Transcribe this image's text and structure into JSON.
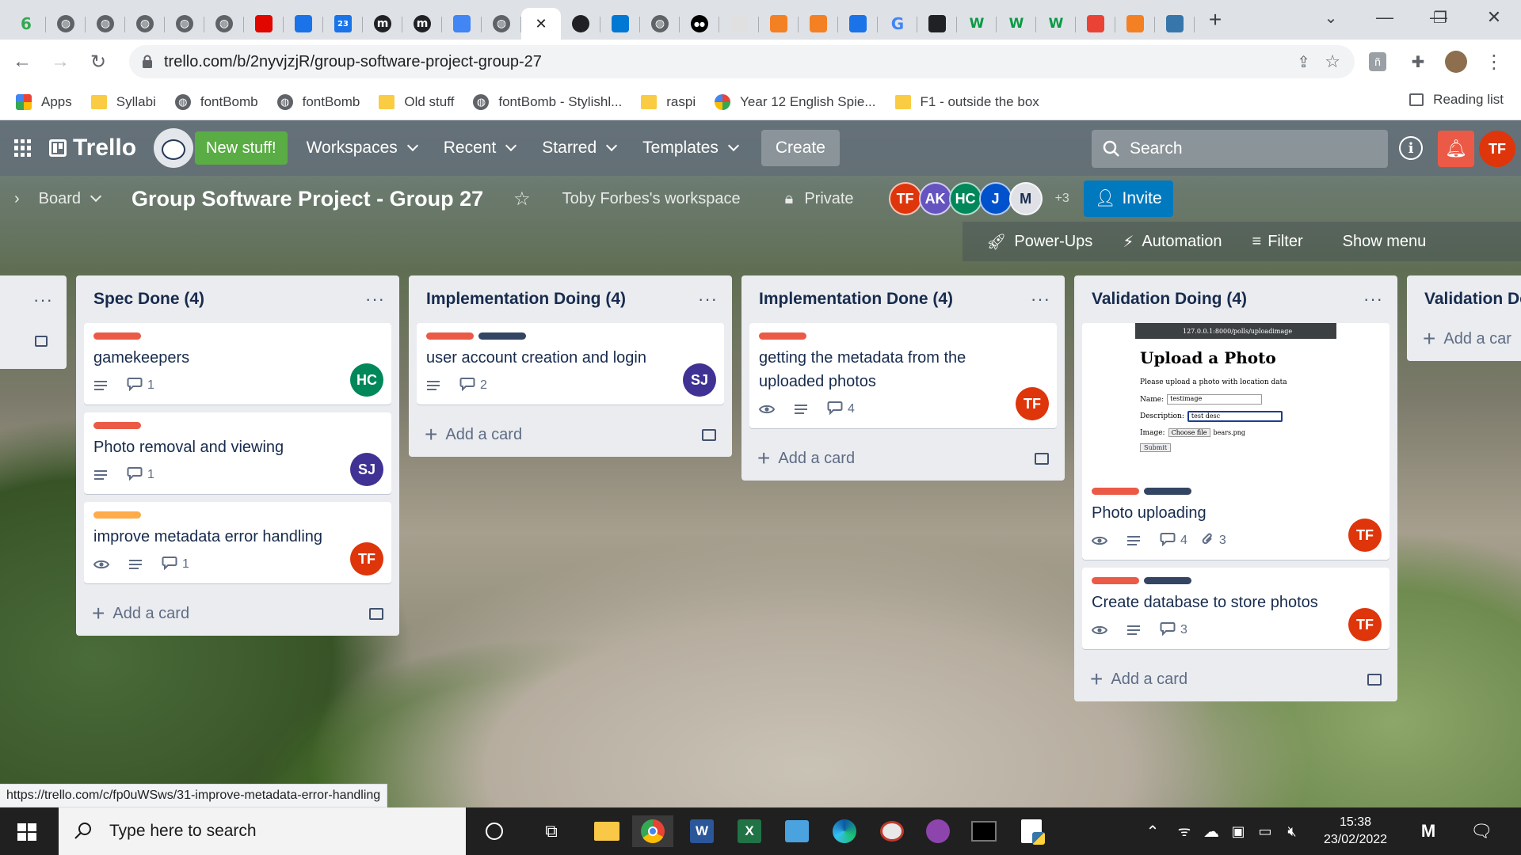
{
  "browser": {
    "tabs": [
      {
        "icon": "6",
        "color": "#34a853"
      },
      {
        "icon": "globe",
        "color": "#5f6368"
      },
      {
        "icon": "globe",
        "color": "#5f6368"
      },
      {
        "icon": "globe",
        "color": "#5f6368"
      },
      {
        "icon": "globe",
        "color": "#5f6368"
      },
      {
        "icon": "globe",
        "color": "#5f6368"
      },
      {
        "icon": "f1",
        "color": "#e10600"
      },
      {
        "icon": "book",
        "color": "#1a73e8"
      },
      {
        "icon": "23",
        "color": "#1a73e8"
      },
      {
        "icon": "m",
        "color": "#202124"
      },
      {
        "icon": "m",
        "color": "#202124"
      },
      {
        "icon": "pen",
        "color": "#4285f4"
      },
      {
        "icon": "globe",
        "color": "#5f6368"
      },
      {
        "icon": "close",
        "color": "#202124",
        "active": true
      },
      {
        "icon": "github",
        "color": "#202124"
      },
      {
        "icon": "outlook",
        "color": "#0078d4"
      },
      {
        "icon": "globe",
        "color": "#5f6368"
      },
      {
        "icon": "medium",
        "color": "#000000"
      },
      {
        "icon": "cube",
        "color": "#e0e0e0"
      },
      {
        "icon": "stack",
        "color": "#f48024"
      },
      {
        "icon": "stack",
        "color": "#f48024"
      },
      {
        "icon": "gps",
        "color": "#1a73e8"
      },
      {
        "icon": "google",
        "color": "#4285f4"
      },
      {
        "icon": "compass",
        "color": "#202124"
      },
      {
        "icon": "w",
        "color": "#0a9a44"
      },
      {
        "icon": "w",
        "color": "#0a9a44"
      },
      {
        "icon": "w",
        "color": "#0a9a44"
      },
      {
        "icon": "maps",
        "color": "#ea4335"
      },
      {
        "icon": "stack",
        "color": "#f48024"
      },
      {
        "icon": "python",
        "color": "#3776ab"
      }
    ],
    "url": "trello.com/b/2nyvjzjR/group-software-project-group-27",
    "bookmarks": [
      {
        "label": "Apps",
        "icon": "apps-grid"
      },
      {
        "label": "Syllabi",
        "icon": "folder"
      },
      {
        "label": "fontBomb",
        "icon": "globe"
      },
      {
        "label": "fontBomb",
        "icon": "globe"
      },
      {
        "label": "Old stuff",
        "icon": "folder"
      },
      {
        "label": "fontBomb - Stylishl...",
        "icon": "globe"
      },
      {
        "label": "raspi",
        "icon": "folder"
      },
      {
        "label": "Year 12 English Spie...",
        "icon": "pinwheel"
      },
      {
        "label": "F1 - outside the box",
        "icon": "folder"
      }
    ],
    "reading_list": "Reading list",
    "status_url": "https://trello.com/c/fp0uWSws/31-improve-metadata-error-handling"
  },
  "trello": {
    "logo": "Trello",
    "new_stuff": "New stuff!",
    "nav": [
      "Workspaces",
      "Recent",
      "Starred",
      "Templates"
    ],
    "create": "Create",
    "search_placeholder": "Search",
    "user_initials": "TF",
    "board": {
      "view": "Board",
      "title": "Group Software Project - Group 27",
      "workspace": "Toby Forbes's workspace",
      "visibility": "Private",
      "members": [
        {
          "initials": "TF",
          "color": "#de350b"
        },
        {
          "initials": "AK",
          "color": "#6554c0"
        },
        {
          "initials": "HC",
          "color": "#00875a"
        },
        {
          "initials": "J",
          "color": "#0052cc"
        },
        {
          "initials": "M",
          "color": "#dfe1e6"
        }
      ],
      "more_members": "+3",
      "invite": "Invite",
      "power_ups": "Power-Ups",
      "automation": "Automation",
      "filter": "Filter",
      "show_menu": "Show menu"
    },
    "lists": [
      {
        "title": "Spec Done (4)",
        "cards": [
          {
            "title": "gamekeepers",
            "labels": [
              "#eb5a46"
            ],
            "watch": false,
            "comments": "1",
            "avatar": {
              "initials": "HC",
              "color": "#00875a"
            }
          },
          {
            "title": "Photo removal and viewing",
            "labels": [
              "#eb5a46"
            ],
            "watch": false,
            "comments": "1",
            "avatar": {
              "initials": "SJ",
              "color": "#403294"
            }
          },
          {
            "title": "improve metadata error handling",
            "labels": [
              "#ffab4a"
            ],
            "watch": true,
            "comments": "1",
            "avatar": {
              "initials": "TF",
              "color": "#de350b"
            }
          }
        ],
        "add": "Add a card"
      },
      {
        "title": "Implementation Doing (4)",
        "cards": [
          {
            "title": "user account creation and login",
            "labels": [
              "#eb5a46",
              "#344563"
            ],
            "watch": false,
            "comments": "2",
            "avatar": {
              "initials": "SJ",
              "color": "#403294"
            }
          }
        ],
        "add": "Add a card"
      },
      {
        "title": "Implementation Done (4)",
        "cards": [
          {
            "title": "getting the metadata from the uploaded photos",
            "labels": [
              "#eb5a46"
            ],
            "watch": true,
            "comments": "4",
            "avatar": {
              "initials": "TF",
              "color": "#de350b"
            }
          }
        ],
        "add": "Add a card"
      },
      {
        "title": "Validation Doing (4)",
        "cards": [
          {
            "title": "Photo uploading",
            "labels": [
              "#eb5a46",
              "#344563"
            ],
            "watch": true,
            "comments": "4",
            "attachments": "3",
            "avatar": {
              "initials": "TF",
              "color": "#de350b"
            },
            "cover": {
              "url": "127.0.0.1:8000/polls/uploadimage",
              "heading": "Upload a Photo",
              "subtitle": "Please upload a photo with location data",
              "name_label": "Name:",
              "name_value": "testimage",
              "desc_label": "Description:",
              "desc_value": "test desc",
              "image_label": "Image:",
              "choose": "Choose file",
              "file": "bears.png",
              "submit": "Submit"
            }
          },
          {
            "title": "Create database to store photos",
            "labels": [
              "#eb5a46",
              "#344563"
            ],
            "watch": true,
            "comments": "3",
            "avatar": {
              "initials": "TF",
              "color": "#de350b"
            }
          }
        ],
        "add": "Add a card"
      },
      {
        "title": "Validation Do",
        "cards": [],
        "add": "Add a car"
      }
    ]
  },
  "taskbar": {
    "search_placeholder": "Type here to search",
    "time": "15:38",
    "date": "23/02/2022"
  }
}
